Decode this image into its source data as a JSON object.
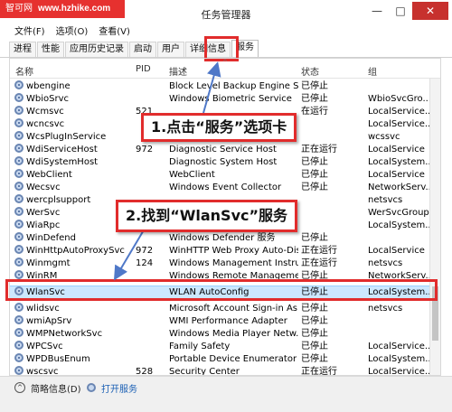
{
  "watermark": {
    "brand": "智可网",
    "site": "www.hzhike.com"
  },
  "window": {
    "title": "任务管理器",
    "minimize": "—",
    "maximize": "□",
    "close": "✕"
  },
  "menu": [
    "文件(F)",
    "选项(O)",
    "查看(V)"
  ],
  "tabs": [
    "进程",
    "性能",
    "应用历史记录",
    "启动",
    "用户",
    "详细信息",
    "服务"
  ],
  "active_tab": "服务",
  "columns": {
    "name": "名称",
    "pid": "PID",
    "desc": "描述",
    "status": "状态",
    "group": "组"
  },
  "rows": [
    {
      "name": "wbengine",
      "pid": "",
      "desc": "Block Level Backup Engine Se...",
      "status": "已停止",
      "group": ""
    },
    {
      "name": "WbioSrvc",
      "pid": "",
      "desc": "Windows Biometric Service",
      "status": "已停止",
      "group": "WbioSvcGro..."
    },
    {
      "name": "Wcmsvc",
      "pid": "521",
      "desc": "",
      "status": "在运行",
      "group": "LocalService..."
    },
    {
      "name": "wcncsvc",
      "pid": "",
      "desc": "",
      "status": "",
      "group": "LocalService..."
    },
    {
      "name": "WcsPlugInService",
      "pid": "",
      "desc": "",
      "status": "",
      "group": "wcssvc"
    },
    {
      "name": "WdiServiceHost",
      "pid": "972",
      "desc": "Diagnostic Service Host",
      "status": "正在运行",
      "group": "LocalService"
    },
    {
      "name": "WdiSystemHost",
      "pid": "",
      "desc": "Diagnostic System Host",
      "status": "已停止",
      "group": "LocalSystem..."
    },
    {
      "name": "WebClient",
      "pid": "",
      "desc": "WebClient",
      "status": "已停止",
      "group": "LocalService"
    },
    {
      "name": "Wecsvc",
      "pid": "",
      "desc": "Windows Event Collector",
      "status": "已停止",
      "group": "NetworkServ..."
    },
    {
      "name": "wercplsupport",
      "pid": "",
      "desc": "",
      "status": "",
      "group": "netsvcs"
    },
    {
      "name": "WerSvc",
      "pid": "",
      "desc": "",
      "status": "",
      "group": "WerSvcGroup"
    },
    {
      "name": "WiaRpc",
      "pid": "",
      "desc": "",
      "status": "",
      "group": "LocalSystem..."
    },
    {
      "name": "WinDefend",
      "pid": "",
      "desc": "Windows Defender 服务",
      "status": "已停止",
      "group": ""
    },
    {
      "name": "WinHttpAutoProxySvc",
      "pid": "972",
      "desc": "WinHTTP Web Proxy Auto-Disc...",
      "status": "正在运行",
      "group": "LocalService"
    },
    {
      "name": "Winmgmt",
      "pid": "124",
      "desc": "Windows Management Instru...",
      "status": "正在运行",
      "group": "netsvcs"
    },
    {
      "name": "WinRM",
      "pid": "",
      "desc": "Windows Remote Manageme...",
      "status": "已停止",
      "group": "NetworkServ..."
    },
    {
      "name": "WlanSvc",
      "pid": "",
      "desc": "WLAN AutoConfig",
      "status": "已停止",
      "group": "LocalSystem..."
    },
    {
      "name": "wlidsvc",
      "pid": "",
      "desc": "Microsoft Account Sign-in As...",
      "status": "已停止",
      "group": "netsvcs"
    },
    {
      "name": "wmiApSrv",
      "pid": "",
      "desc": "WMI Performance Adapter",
      "status": "已停止",
      "group": ""
    },
    {
      "name": "WMPNetworkSvc",
      "pid": "",
      "desc": "Windows Media Player Netw...",
      "status": "已停止",
      "group": ""
    },
    {
      "name": "WPCSvc",
      "pid": "",
      "desc": "Family Safety",
      "status": "已停止",
      "group": "LocalService..."
    },
    {
      "name": "WPDBusEnum",
      "pid": "",
      "desc": "Portable Device Enumerator ...",
      "status": "已停止",
      "group": "LocalSystem..."
    },
    {
      "name": "wscsvc",
      "pid": "528",
      "desc": "Security Center",
      "status": "正在运行",
      "group": "LocalService..."
    }
  ],
  "selected_row": "WlanSvc",
  "callouts": {
    "step1": "1.点击“服务”选项卡",
    "step2": "2.找到“WlanSvc”服务"
  },
  "footer": {
    "less_details": "简略信息(D)",
    "open_services": "打开服务"
  },
  "colors": {
    "highlight": "#e12c2c",
    "selection": "#cce8ff",
    "link": "#1a5fb4",
    "close_button": "#c7312e",
    "watermark_bg": "#e6312f"
  }
}
